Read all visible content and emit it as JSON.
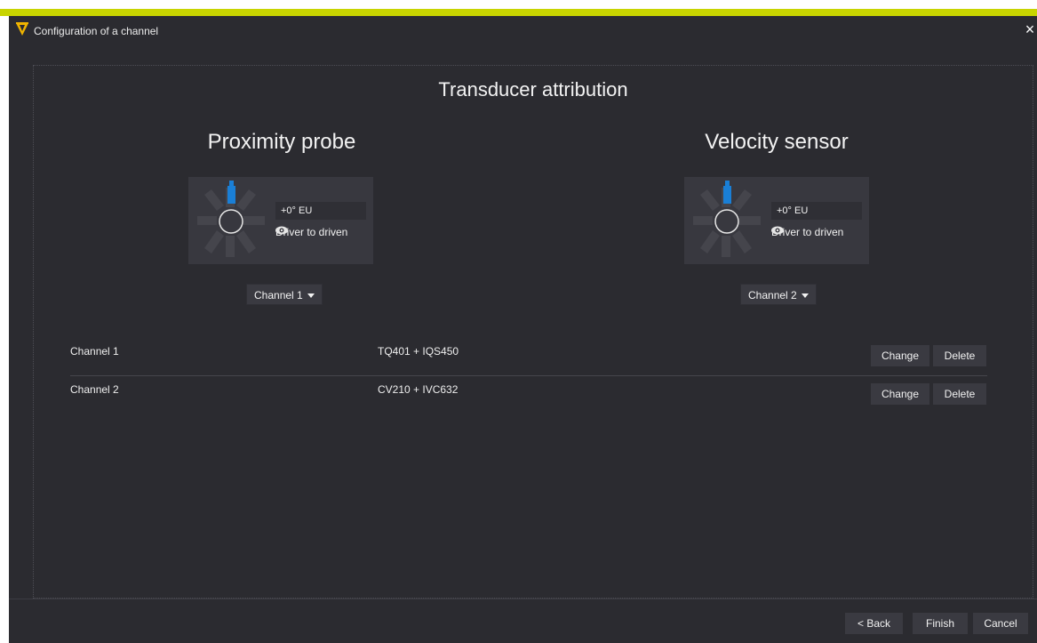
{
  "window": {
    "title": "Configuration of a channel",
    "close_glyph": "×",
    "accent_color": "#c8d400",
    "icons": {
      "logo": "app-logo-icon",
      "close": "close-icon"
    }
  },
  "main": {
    "heading": "Transducer attribution",
    "sensors": [
      {
        "title": "Proximity probe",
        "angle": "+0° EU",
        "direction": "Driver to driven",
        "channel_select": "Channel 1",
        "probe_color": "#1a7fd6"
      },
      {
        "title": "Velocity sensor",
        "angle": "+0° EU",
        "direction": "Driver to driven",
        "channel_select": "Channel 2",
        "probe_color": "#1a7fd6"
      }
    ],
    "channels": [
      {
        "name": "Channel 1",
        "transducer": "TQ401 + IQS450",
        "change_label": "Change",
        "delete_label": "Delete"
      },
      {
        "name": "Channel 2",
        "transducer": "CV210 + IVC632",
        "change_label": "Change",
        "delete_label": "Delete"
      }
    ]
  },
  "footer": {
    "back_label": "< Back",
    "finish_label": "Finish",
    "cancel_label": "Cancel"
  }
}
